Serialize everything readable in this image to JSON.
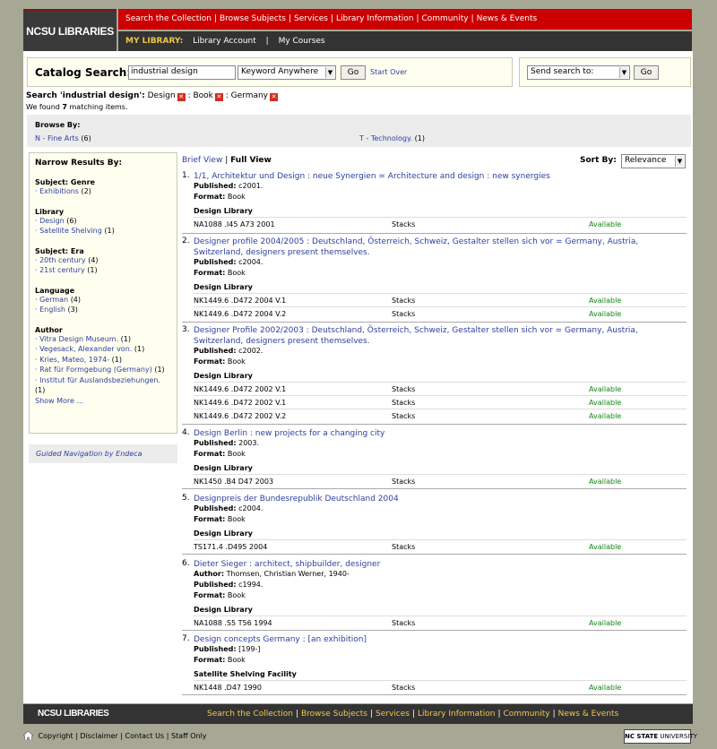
{
  "header": {
    "logo": "NCSU LIBRARIES",
    "top_nav": [
      "Search the Collection",
      "Browse Subjects",
      "Services",
      "Library Information",
      "Community",
      "News & Events"
    ],
    "my_library_label": "MY LIBRARY:",
    "my_library_links": [
      "Library Account",
      "My Courses"
    ]
  },
  "catalog_search": {
    "label": "Catalog Search:",
    "query": "industrial design",
    "field": "Keyword Anywhere",
    "go": "Go",
    "start_over": "Start Over"
  },
  "send_search": {
    "field": "Send search to:",
    "go": "Go"
  },
  "breadcrumb": {
    "prefix": "Search 'industrial design':",
    "filters": [
      "Design",
      "Book",
      "Germany"
    ]
  },
  "found": {
    "text_pre": "We found",
    "count": "7",
    "text_post": "matching items."
  },
  "browse": {
    "label": "Browse By:",
    "items": [
      {
        "label": "N - Fine Arts",
        "count": "(6)"
      },
      {
        "label": "T - Technology.",
        "count": "(1)"
      }
    ]
  },
  "narrow": {
    "title": "Narrow Results By:",
    "groups": [
      {
        "heading": "Subject: Genre",
        "items": [
          {
            "label": "Exhibitions",
            "count": "(2)"
          }
        ]
      },
      {
        "heading": "Library",
        "items": [
          {
            "label": "Design",
            "count": "(6)"
          },
          {
            "label": "Satellite Shelving",
            "count": "(1)"
          }
        ]
      },
      {
        "heading": "Subject: Era",
        "items": [
          {
            "label": "20th century",
            "count": "(4)"
          },
          {
            "label": "21st century",
            "count": "(1)"
          }
        ]
      },
      {
        "heading": "Language",
        "items": [
          {
            "label": "German",
            "count": "(4)"
          },
          {
            "label": "English",
            "count": "(3)"
          }
        ]
      },
      {
        "heading": "Author",
        "items": [
          {
            "label": "Vitra Design Museum.",
            "count": "(1)"
          },
          {
            "label": "Vegesack, Alexander von.",
            "count": "(1)"
          },
          {
            "label": "Kries, Mateo, 1974-",
            "count": "(1)"
          },
          {
            "label": "Rat für Formgebung (Germany)",
            "count": "(1)"
          },
          {
            "label": "Institut für Auslandsbeziehungen.",
            "count": "(1)"
          }
        ]
      }
    ],
    "show_more": "Show More ..."
  },
  "guided": "Guided Navigation by Endeca",
  "views": {
    "brief": "Brief View",
    "sep": "|",
    "full": "Full View"
  },
  "sort": {
    "label": "Sort By:",
    "value": "Relevance"
  },
  "results": [
    {
      "num": "1.",
      "title": "1/1, Architektur und Design : neue Synergien = Architecture and design : new synergies",
      "author": "",
      "published": "c2001.",
      "format": "Book",
      "location": "Design Library",
      "holdings": [
        [
          "NA1088 .I45 A73 2001",
          "Stacks",
          "Available"
        ]
      ]
    },
    {
      "num": "2.",
      "title": "Designer profile 2004/2005 : Deutschland, Österreich, Schweiz, Gestalter stellen sich vor = Germany, Austria, Switzerland, designers present themselves.",
      "author": "",
      "published": "c2004.",
      "format": "Book",
      "location": "Design Library",
      "holdings": [
        [
          "NK1449.6 .D472 2004 V.1",
          "Stacks",
          "Available"
        ],
        [
          "NK1449.6 .D472 2004 V.2",
          "Stacks",
          "Available"
        ]
      ]
    },
    {
      "num": "3.",
      "title": "Designer Profile 2002/2003 : Deutschland, Österreich, Schweiz, Gestalter stellen sich vor = Germany, Austria, Switzerland, designers present themselves.",
      "author": "",
      "published": "c2002.",
      "format": "Book",
      "location": "Design Library",
      "holdings": [
        [
          "NK1449.6 .D472 2002 V.1",
          "Stacks",
          "Available"
        ],
        [
          "NK1449.6 .D472 2002 V.1",
          "Stacks",
          "Available"
        ],
        [
          "NK1449.6 .D472 2002 V.2",
          "Stacks",
          "Available"
        ]
      ]
    },
    {
      "num": "4.",
      "title": "Design Berlin : new projects for a changing city",
      "author": "",
      "published": "2003.",
      "format": "Book",
      "location": "Design Library",
      "holdings": [
        [
          "NK1450 .B4 D47 2003",
          "Stacks",
          "Available"
        ]
      ]
    },
    {
      "num": "5.",
      "title": "Designpreis der Bundesrepublik Deutschland 2004",
      "author": "",
      "published": "c2004.",
      "format": "Book",
      "location": "Design Library",
      "holdings": [
        [
          "TS171.4 .D495 2004",
          "Stacks",
          "Available"
        ]
      ]
    },
    {
      "num": "6.",
      "title": "Dieter Sieger : architect, shipbuilder, designer",
      "author": "Thomsen, Christian Werner, 1940-",
      "published": "c1994.",
      "format": "Book",
      "location": "Design Library",
      "holdings": [
        [
          "NA1088 .S5 T56 1994",
          "Stacks",
          "Available"
        ]
      ]
    },
    {
      "num": "7.",
      "title": "Design concepts Germany : [an exhibition]",
      "author": "",
      "published": "[199-]",
      "format": "Book",
      "location": "Satellite Shelving Facility",
      "holdings": [
        [
          "NK1448 .D47 1990",
          "Stacks",
          "Available"
        ]
      ]
    }
  ],
  "labels": {
    "author": "Author:",
    "published": "Published:",
    "format": "Format:"
  },
  "footer": {
    "logo": "NCSU LIBRARIES",
    "nav": [
      "Search the Collection",
      "Browse Subjects",
      "Services",
      "Library Information",
      "Community",
      "News & Events"
    ],
    "links": [
      "Copyright",
      "Disclaimer",
      "Contact Us",
      "Staff Only"
    ],
    "ncstate_bold": "NC STATE",
    "ncstate_rest": "UNIVERSITY"
  },
  "colors": {
    "header_red": "#cc0000",
    "link": "#2e3f9e",
    "available": "#118811",
    "page_bg": "#a7a795"
  }
}
